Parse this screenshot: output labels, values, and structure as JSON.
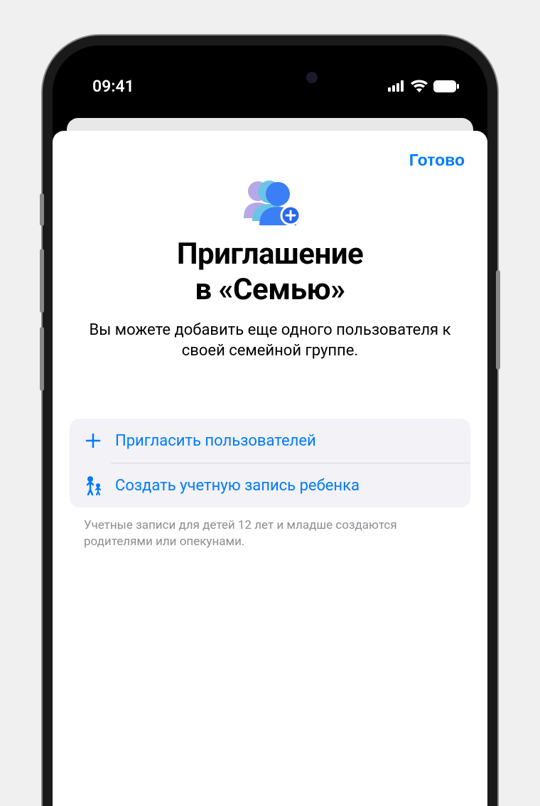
{
  "status": {
    "time": "09:41"
  },
  "sheet": {
    "done_label": "Готово",
    "title_line1": "Приглашение",
    "title_line2": "в «Семью»",
    "subtitle": "Вы можете добавить еще одного пользователя к своей семейной группе.",
    "options": {
      "invite_label": "Пригласить пользователей",
      "create_child_label": "Создать учетную запись ребенка"
    },
    "footer_note": "Учетные записи для детей 12 лет и младше создаются родителями или опекунами."
  },
  "colors": {
    "accent": "#007AFF"
  }
}
